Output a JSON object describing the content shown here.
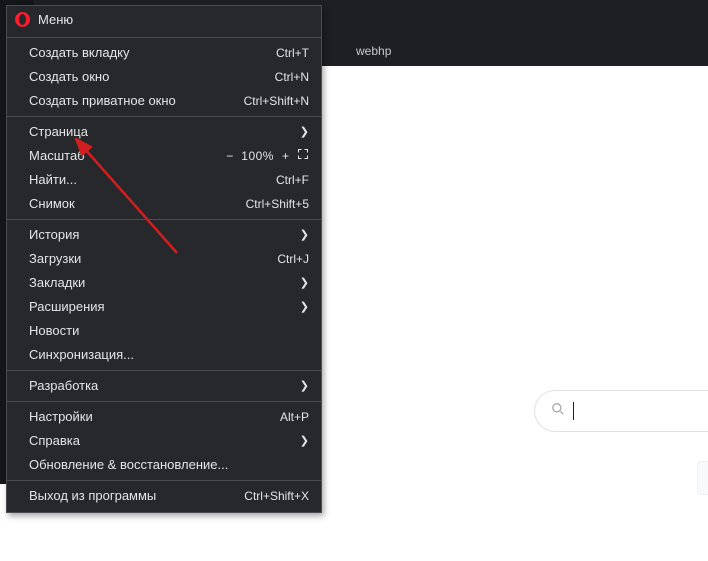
{
  "header": {
    "url_fragment": "webhp"
  },
  "menu": {
    "title": "Меню",
    "groups": [
      [
        {
          "key": "new-tab",
          "label": "Создать вкладку",
          "shortcut": "Ctrl+T"
        },
        {
          "key": "new-window",
          "label": "Создать окно",
          "shortcut": "Ctrl+N"
        },
        {
          "key": "new-private",
          "label": "Создать приватное окно",
          "shortcut": "Ctrl+Shift+N"
        }
      ],
      [
        {
          "key": "page",
          "label": "Страница",
          "submenu": true
        },
        {
          "key": "zoom",
          "label": "Масштаб",
          "zoom": {
            "minus": "−",
            "value": "100%",
            "plus": "+",
            "fs": true
          }
        },
        {
          "key": "find",
          "label": "Найти...",
          "shortcut": "Ctrl+F"
        },
        {
          "key": "snap",
          "label": "Снимок",
          "shortcut": "Ctrl+Shift+5"
        }
      ],
      [
        {
          "key": "history",
          "label": "История",
          "submenu": true
        },
        {
          "key": "downloads",
          "label": "Загрузки",
          "shortcut": "Ctrl+J"
        },
        {
          "key": "bookmarks",
          "label": "Закладки",
          "submenu": true
        },
        {
          "key": "extensions",
          "label": "Расширения",
          "submenu": true
        },
        {
          "key": "news",
          "label": "Новости"
        },
        {
          "key": "sync",
          "label": "Синхронизация..."
        }
      ],
      [
        {
          "key": "dev",
          "label": "Разработка",
          "submenu": true
        }
      ],
      [
        {
          "key": "settings",
          "label": "Настройки",
          "shortcut": "Alt+P"
        },
        {
          "key": "help",
          "label": "Справка",
          "submenu": true
        },
        {
          "key": "update",
          "label": "Обновление & восстановление..."
        }
      ],
      [
        {
          "key": "exit",
          "label": "Выход из программы",
          "shortcut": "Ctrl+Shift+X"
        }
      ]
    ]
  },
  "search": {
    "placeholder": ""
  }
}
